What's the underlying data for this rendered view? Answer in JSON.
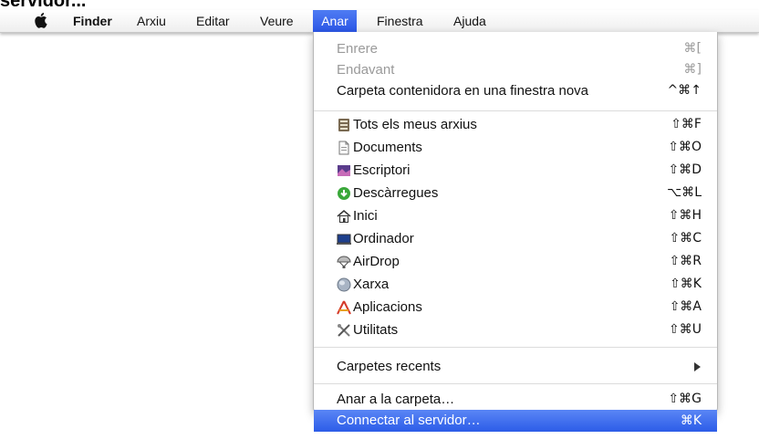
{
  "top_caption": "servidor...",
  "menubar": {
    "items": [
      {
        "label": "Finder"
      },
      {
        "label": "Arxiu"
      },
      {
        "label": "Editar"
      },
      {
        "label": "Veure"
      },
      {
        "label": "Anar"
      },
      {
        "label": "Finestra"
      },
      {
        "label": "Ajuda"
      }
    ]
  },
  "menu": {
    "nav": [
      {
        "label": "Enrere",
        "shortcut": "⌘["
      },
      {
        "label": "Endavant",
        "shortcut": "⌘]"
      },
      {
        "label": "Carpeta contenidora en una finestra nova",
        "shortcut": "^⌘↑"
      }
    ],
    "places": [
      {
        "label": "Tots els meus arxius",
        "shortcut": "⇧⌘F",
        "icon": "all-files-icon"
      },
      {
        "label": "Documents",
        "shortcut": "⇧⌘O",
        "icon": "documents-icon"
      },
      {
        "label": "Escriptori",
        "shortcut": "⇧⌘D",
        "icon": "desktop-icon"
      },
      {
        "label": "Descàrregues",
        "shortcut": "⌥⌘L",
        "icon": "downloads-icon"
      },
      {
        "label": "Inici",
        "shortcut": "⇧⌘H",
        "icon": "home-icon"
      },
      {
        "label": "Ordinador",
        "shortcut": "⇧⌘C",
        "icon": "computer-icon"
      },
      {
        "label": "AirDrop",
        "shortcut": "⇧⌘R",
        "icon": "airdrop-icon"
      },
      {
        "label": "Xarxa",
        "shortcut": "⇧⌘K",
        "icon": "network-icon"
      },
      {
        "label": "Aplicacions",
        "shortcut": "⇧⌘A",
        "icon": "applications-icon"
      },
      {
        "label": "Utilitats",
        "shortcut": "⇧⌘U",
        "icon": "utilities-icon"
      }
    ],
    "recent": {
      "label": "Carpetes recents"
    },
    "goto": {
      "label": "Anar a la carpeta…",
      "shortcut": "⇧⌘G"
    },
    "connect": {
      "label": "Connectar al servidor…",
      "shortcut": "⌘K"
    }
  },
  "colors": {
    "highlight": "#2c5ce8",
    "disabled_text": "#9a9a9a"
  }
}
